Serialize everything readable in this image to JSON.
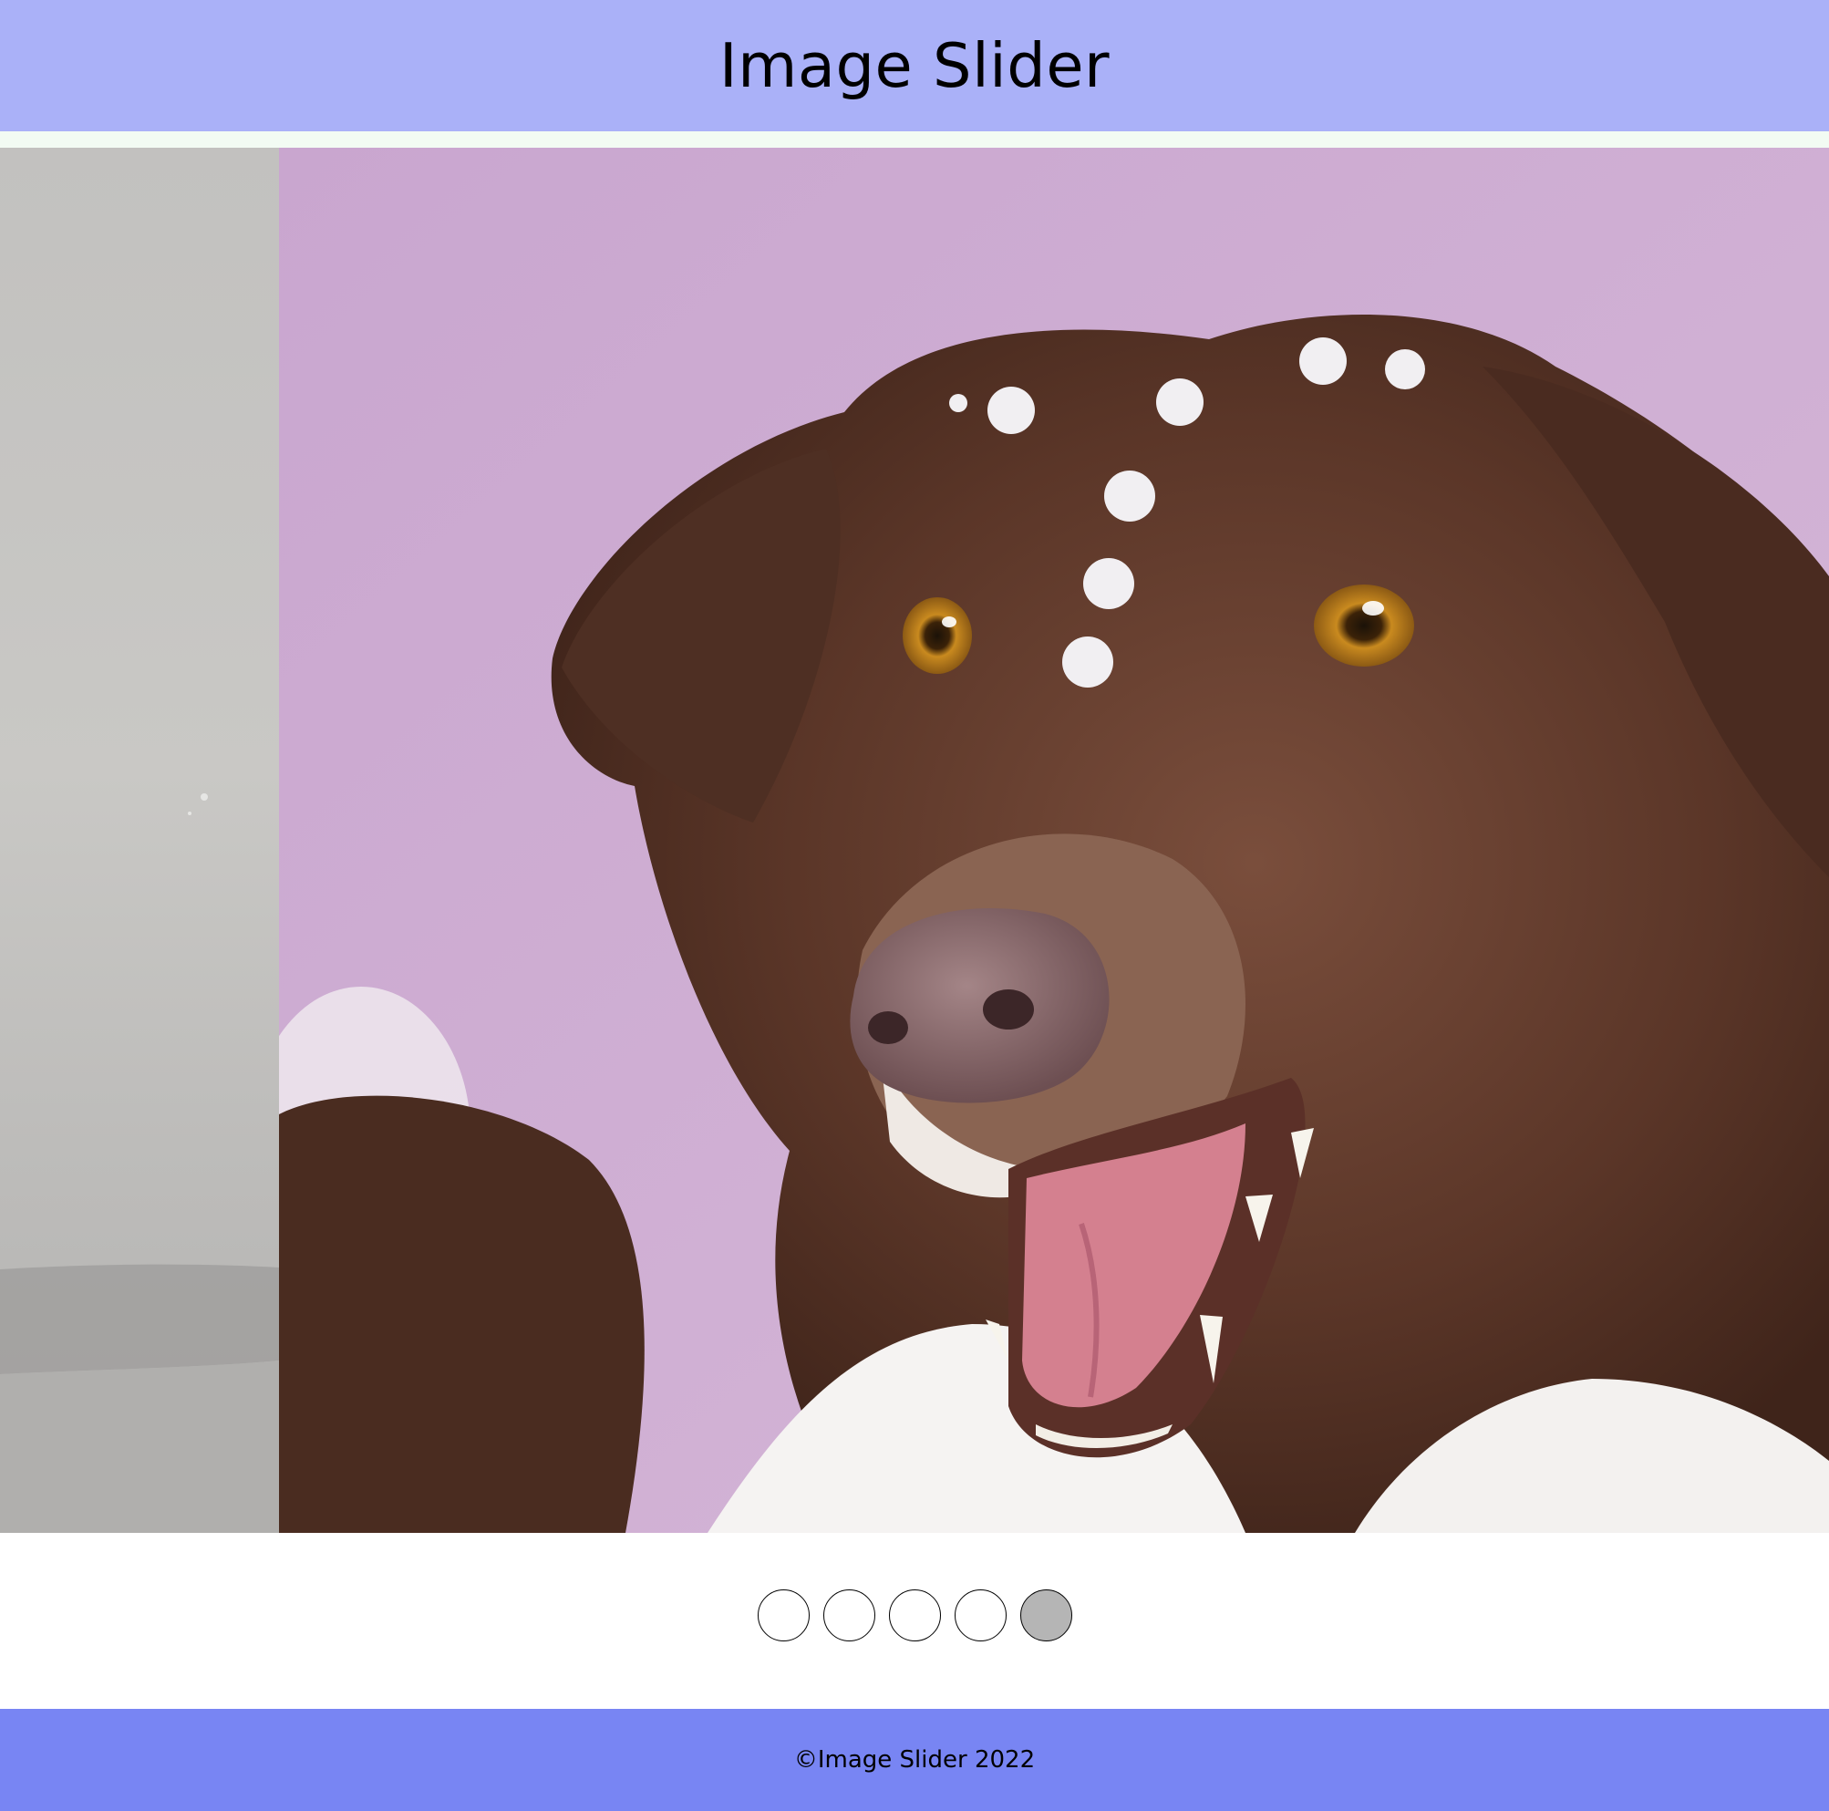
{
  "header": {
    "title": "Image Slider"
  },
  "slider": {
    "slides": [
      {
        "subject": "pavement photo"
      },
      {
        "subject": "brown and white dog with flowers on forehead"
      }
    ],
    "dots": [
      {
        "active": false
      },
      {
        "active": false
      },
      {
        "active": false
      },
      {
        "active": false
      },
      {
        "active": true
      }
    ]
  },
  "footer": {
    "copyright": "©Image Slider 2022"
  },
  "colors": {
    "header_bg": "#aab1f8",
    "footer_bg": "#7885f3",
    "active_dot": "#b5b5b5"
  }
}
